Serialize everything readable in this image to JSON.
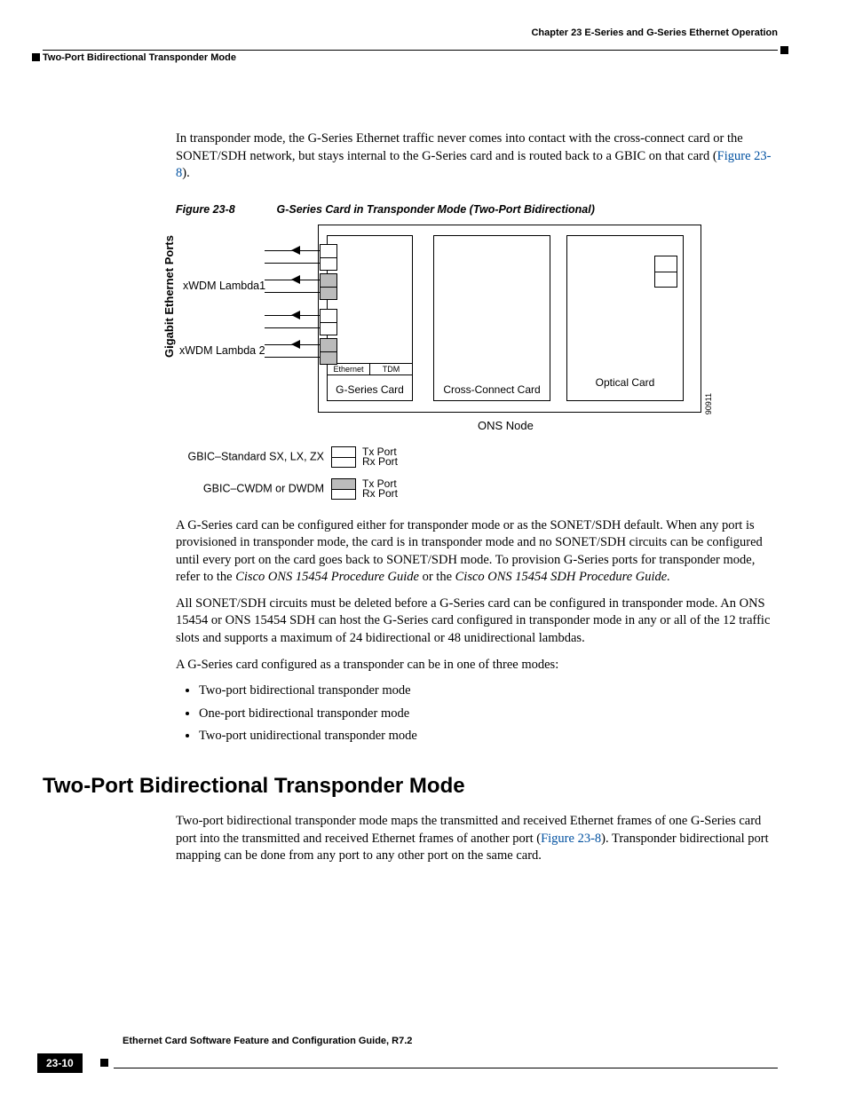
{
  "header": {
    "chapter": "Chapter 23 E-Series and G-Series Ethernet Operation",
    "section": "Two-Port Bidirectional Transponder Mode"
  },
  "para1a": "In transponder mode, the G-Series Ethernet traffic never comes into contact with the cross-connect card or the SONET/SDH network, but stays internal to the G-Series card and is routed back to a GBIC on that card (",
  "figlink1": "Figure 23-8",
  "para1b": ").",
  "figure": {
    "num": "Figure 23-8",
    "title": "G-Series Card in Transponder Mode (Two-Port Bidirectional)",
    "vlabel": "Gigabit Ethernet Ports",
    "lambda1": "xWDM Lambda1",
    "lambda2": "xWDM Lambda 2",
    "ethernet": "Ethernet",
    "tdm": "TDM",
    "gseries": "G-Series Card",
    "crossconnect": "Cross-Connect Card",
    "optical": "Optical Card",
    "ons": "ONS Node",
    "id": "90911",
    "legend1": "GBIC–Standard SX, LX, ZX",
    "legend2": "GBIC–CWDM or DWDM",
    "txport": "Tx Port",
    "rxport": "Rx Port"
  },
  "para2a": "A G-Series card can be configured either for transponder mode or as the SONET/SDH default. When any port is provisioned in transponder mode, the card is in transponder mode and no SONET/SDH circuits can be configured until every port on the card goes back to SONET/SDH mode. To provision G-Series ports for transponder mode",
  "para2b": ", refer to the ",
  "ref1": "Cisco ONS 15454 Procedure Guide",
  "para2c": " or the ",
  "ref2": "Cisco ONS 15454 SDH Procedure Guide.",
  "para3": "All SONET/SDH circuits must be deleted before a G-Series card can be configured in transponder mode. An ONS 15454 or ONS 15454 SDH can host the G-Series card configured in transponder mode in any or all of the 12 traffic slots and supports a maximum of 24 bidirectional or 48 unidirectional lambdas.",
  "para4": "A G-Series card configured as a transponder can be in one of three modes:",
  "bullets": [
    "Two-port bidirectional transponder mode",
    "One-port bidirectional transponder mode",
    "Two-port unidirectional transponder mode"
  ],
  "h2": "Two-Port Bidirectional Transponder Mode",
  "para5a": "Two-port bidirectional transponder mode maps the transmitted and received Ethernet frames of one G-Series card port into the transmitted and received Ethernet frames of another port (",
  "figlink2": "Figure 23-8",
  "para5b": "). Transponder bidirectional port mapping can be done from any port to any other port on the same card.",
  "footer": {
    "title": "Ethernet Card Software Feature and Configuration Guide, R7.2",
    "page": "23-10"
  }
}
